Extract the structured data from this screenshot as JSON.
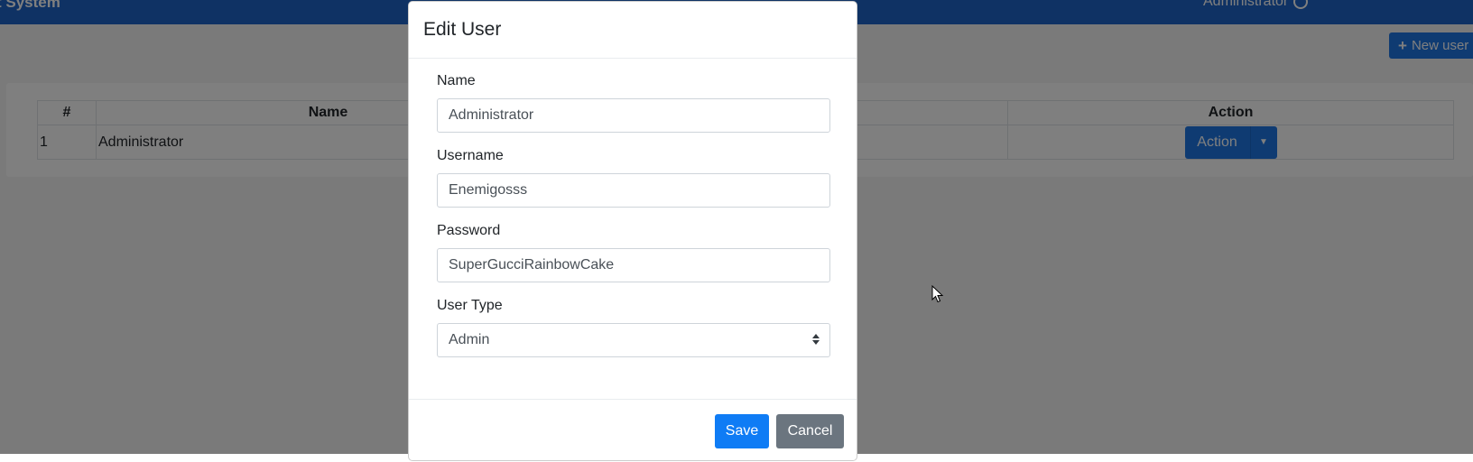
{
  "topbar": {
    "brand": "t System",
    "user_name": "Administrator"
  },
  "toolbar": {
    "new_user_label": "New user"
  },
  "table": {
    "headers": [
      "#",
      "Name",
      "Action"
    ],
    "rows": [
      {
        "index": "1",
        "name": "Administrator",
        "action_label": "Action"
      }
    ]
  },
  "modal": {
    "title": "Edit User",
    "fields": {
      "name": {
        "label": "Name",
        "value": "Administrator"
      },
      "username": {
        "label": "Username",
        "value": "Enemigosss"
      },
      "password": {
        "label": "Password",
        "value": "SuperGucciRainbowCake"
      },
      "user_type": {
        "label": "User Type",
        "value": "Admin"
      }
    },
    "save_label": "Save",
    "cancel_label": "Cancel"
  },
  "colors": {
    "primary": "#1f77e5",
    "navbar": "#1f65c8",
    "secondary": "#6b757f",
    "backdrop": "rgba(0,0,0,0.5)"
  },
  "icons": {
    "new_user": "plus-icon",
    "user_menu": "power-icon",
    "select": "updown-arrows-icon",
    "dropdown": "caret-down-icon"
  }
}
